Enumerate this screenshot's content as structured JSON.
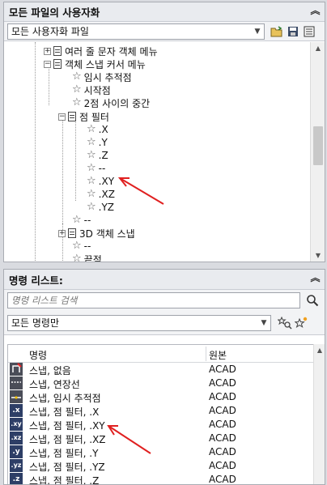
{
  "panel1": {
    "title": "모든 파일의 사용자화",
    "file_combo": "모든 사용자화 파일",
    "tree": [
      {
        "label": "여러 줄 문자 객체 메뉴",
        "kind": "menu",
        "expander": "+"
      },
      {
        "label": "객체 스냅 커서 메뉴",
        "kind": "menu",
        "expander": "−"
      },
      {
        "label": "임시 추적점",
        "kind": "star"
      },
      {
        "label": "시작점",
        "kind": "star"
      },
      {
        "label": "2점 사이의 중간",
        "kind": "star"
      },
      {
        "label": "점 필터",
        "kind": "menu",
        "expander": "−"
      },
      {
        "label": ".X",
        "kind": "star"
      },
      {
        "label": ".Y",
        "kind": "star"
      },
      {
        "label": ".Z",
        "kind": "star"
      },
      {
        "label": "--",
        "kind": "star"
      },
      {
        "label": ".XY",
        "kind": "star"
      },
      {
        "label": ".XZ",
        "kind": "star"
      },
      {
        "label": ".YZ",
        "kind": "star"
      },
      {
        "label": "--",
        "kind": "star"
      },
      {
        "label": "3D 객체 스냅",
        "kind": "menu",
        "expander": "+"
      },
      {
        "label": "--",
        "kind": "star"
      },
      {
        "label": "끝점",
        "kind": "star"
      }
    ]
  },
  "panel2": {
    "title": "명령 리스트:",
    "search_placeholder": "명령 리스트 검색",
    "filter_combo": "모든 명령만",
    "columns": {
      "name": "명령",
      "source": "원본"
    },
    "rows": [
      {
        "icon": "",
        "name": "스냅, 없음",
        "source": "ACAD"
      },
      {
        "icon": "",
        "name": "스냅, 연장선",
        "source": "ACAD"
      },
      {
        "icon": "",
        "name": "스냅, 임시 추적점",
        "source": "ACAD"
      },
      {
        "icon": ".x",
        "name": "스냅, 점 필터, .X",
        "source": "ACAD"
      },
      {
        "icon": ".xy",
        "name": "스냅, 점 필터, .XY",
        "source": "ACAD"
      },
      {
        "icon": ".xz",
        "name": "스냅, 점 필터, .XZ",
        "source": "ACAD"
      },
      {
        "icon": ".y",
        "name": "스냅, 점 필터, .Y",
        "source": "ACAD"
      },
      {
        "icon": ".yz",
        "name": "스냅, 점 필터, .YZ",
        "source": "ACAD"
      },
      {
        "icon": ".z",
        "name": "스냅, 점 필터, .Z",
        "source": "ACAD"
      }
    ]
  },
  "colors": {
    "annotation_arrow": "#e02020",
    "header_bg": "#e9ebef"
  }
}
